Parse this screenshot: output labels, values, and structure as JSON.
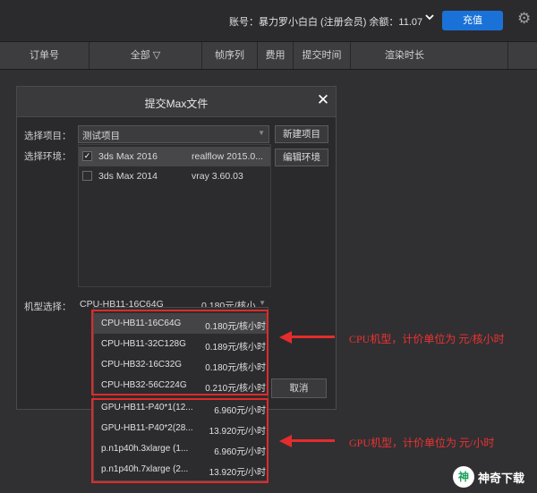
{
  "topbar": {
    "account_text": "账号：暴力罗小白白 (注册会员)  余额：11.07",
    "recharge_label": "充值",
    "icons": {
      "account_menu": "chevron-down-icon",
      "settings": "gear-icon"
    }
  },
  "table": {
    "headers": [
      "订单号",
      "全部 ▽",
      "帧序列",
      "费用",
      "提交时间",
      "渲染时长"
    ]
  },
  "dialog": {
    "title": "提交Max文件",
    "project_label": "选择项目：",
    "project_value": "测试项目",
    "new_project_label": "新建项目",
    "env_label": "选择环境：",
    "edit_env_label": "编辑环境",
    "environments": [
      {
        "name": "3ds Max 2016",
        "plugin": "realflow 2015.0...",
        "checked": true
      },
      {
        "name": "3ds Max 2014",
        "plugin": "vray 3.60.03",
        "checked": false
      }
    ],
    "machine_label": "机型选择：",
    "machine_value": "CPU-HB11-16C64G",
    "machine_price": "0.180元/核小...",
    "cancel_label": "取消"
  },
  "dropdown": {
    "cpu_options": [
      {
        "name": "CPU-HB11-16C64G",
        "price": "0.180元/核小时"
      },
      {
        "name": "CPU-HB11-32C128G",
        "price": "0.189元/核小时"
      },
      {
        "name": "CPU-HB32-16C32G",
        "price": "0.180元/核小时"
      },
      {
        "name": "CPU-HB32-56C224G",
        "price": "0.210元/核小时"
      }
    ],
    "gpu_options": [
      {
        "name": "GPU-HB11-P40*1(12...",
        "price": "6.960元/小时"
      },
      {
        "name": "GPU-HB11-P40*2(28...",
        "price": "13.920元/小时"
      },
      {
        "name": "p.n1p40h.3xlarge (1...",
        "price": "6.960元/小时"
      },
      {
        "name": "p.n1p40h.7xlarge (2...",
        "price": "13.920元/小时"
      }
    ]
  },
  "annotations": {
    "cpu_note": "CPU机型，计价单位为 元/核小时",
    "gpu_note": "GPU机型，计价单位为 元/小时",
    "color": "#e52c2c"
  },
  "watermark": {
    "text": "神奇下载",
    "logo": "神"
  }
}
